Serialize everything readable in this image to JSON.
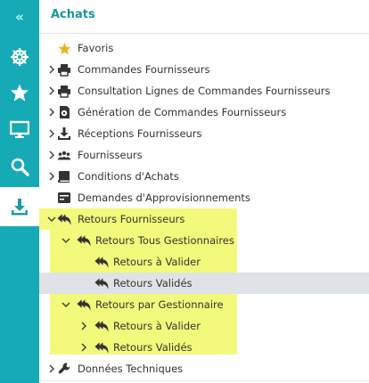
{
  "title": "Achats",
  "rail": {
    "collapse_glyph": "«",
    "items": [
      {
        "icon": "gear-wheel-icon"
      },
      {
        "icon": "star-icon"
      },
      {
        "icon": "monitor-icon"
      },
      {
        "icon": "search-icon"
      },
      {
        "icon": "download-icon",
        "active": true
      }
    ]
  },
  "menu": [
    {
      "label": "Favoris",
      "icon": "star-icon",
      "expander": "none",
      "level": 0
    },
    {
      "label": "Commandes Fournisseurs",
      "icon": "printer-icon",
      "expander": "collapsed",
      "level": 0
    },
    {
      "label": "Consultation Lignes de Commandes Fournisseurs",
      "icon": "printer-icon",
      "expander": "collapsed",
      "level": 0
    },
    {
      "label": "Génération de Commandes Fournisseurs",
      "icon": "gear-doc-icon",
      "expander": "collapsed",
      "level": 0
    },
    {
      "label": "Réceptions Fournisseurs",
      "icon": "download-icon",
      "expander": "collapsed",
      "level": 0
    },
    {
      "label": "Fournisseurs",
      "icon": "people-icon",
      "expander": "collapsed",
      "level": 0
    },
    {
      "label": "Conditions d'Achats",
      "icon": "book-icon",
      "expander": "collapsed",
      "level": 0
    },
    {
      "label": "Demandes d'Approvisionnements",
      "icon": "card-icon",
      "expander": "none",
      "level": 0
    },
    {
      "label": "Retours Fournisseurs",
      "icon": "reply-all-icon",
      "expander": "expanded",
      "level": 0
    },
    {
      "label": "Retours Tous Gestionnaires",
      "icon": "reply-all-icon",
      "expander": "expanded",
      "level": 1
    },
    {
      "label": "Retours à Valider",
      "icon": "reply-all-icon",
      "expander": "none",
      "level": 2
    },
    {
      "label": "Retours Validés",
      "icon": "reply-all-icon",
      "expander": "none",
      "level": 2,
      "selected": true
    },
    {
      "label": "Retours par Gestionnaire",
      "icon": "reply-all-icon",
      "expander": "expanded",
      "level": 1
    },
    {
      "label": "Retours à Valider",
      "icon": "reply-all-icon",
      "expander": "collapsed",
      "level": 2
    },
    {
      "label": "Retours Validés",
      "icon": "reply-all-icon",
      "expander": "collapsed",
      "level": 2
    },
    {
      "label": "Données Techniques",
      "icon": "wrench-icon",
      "expander": "collapsed",
      "level": 0
    }
  ],
  "colors": {
    "rail": "#15aab5",
    "title": "#1797a5",
    "highlight": "#ebf528",
    "selected_row": "#dfe2e6",
    "star": "#f2b01e",
    "icon_dark": "#333333"
  }
}
